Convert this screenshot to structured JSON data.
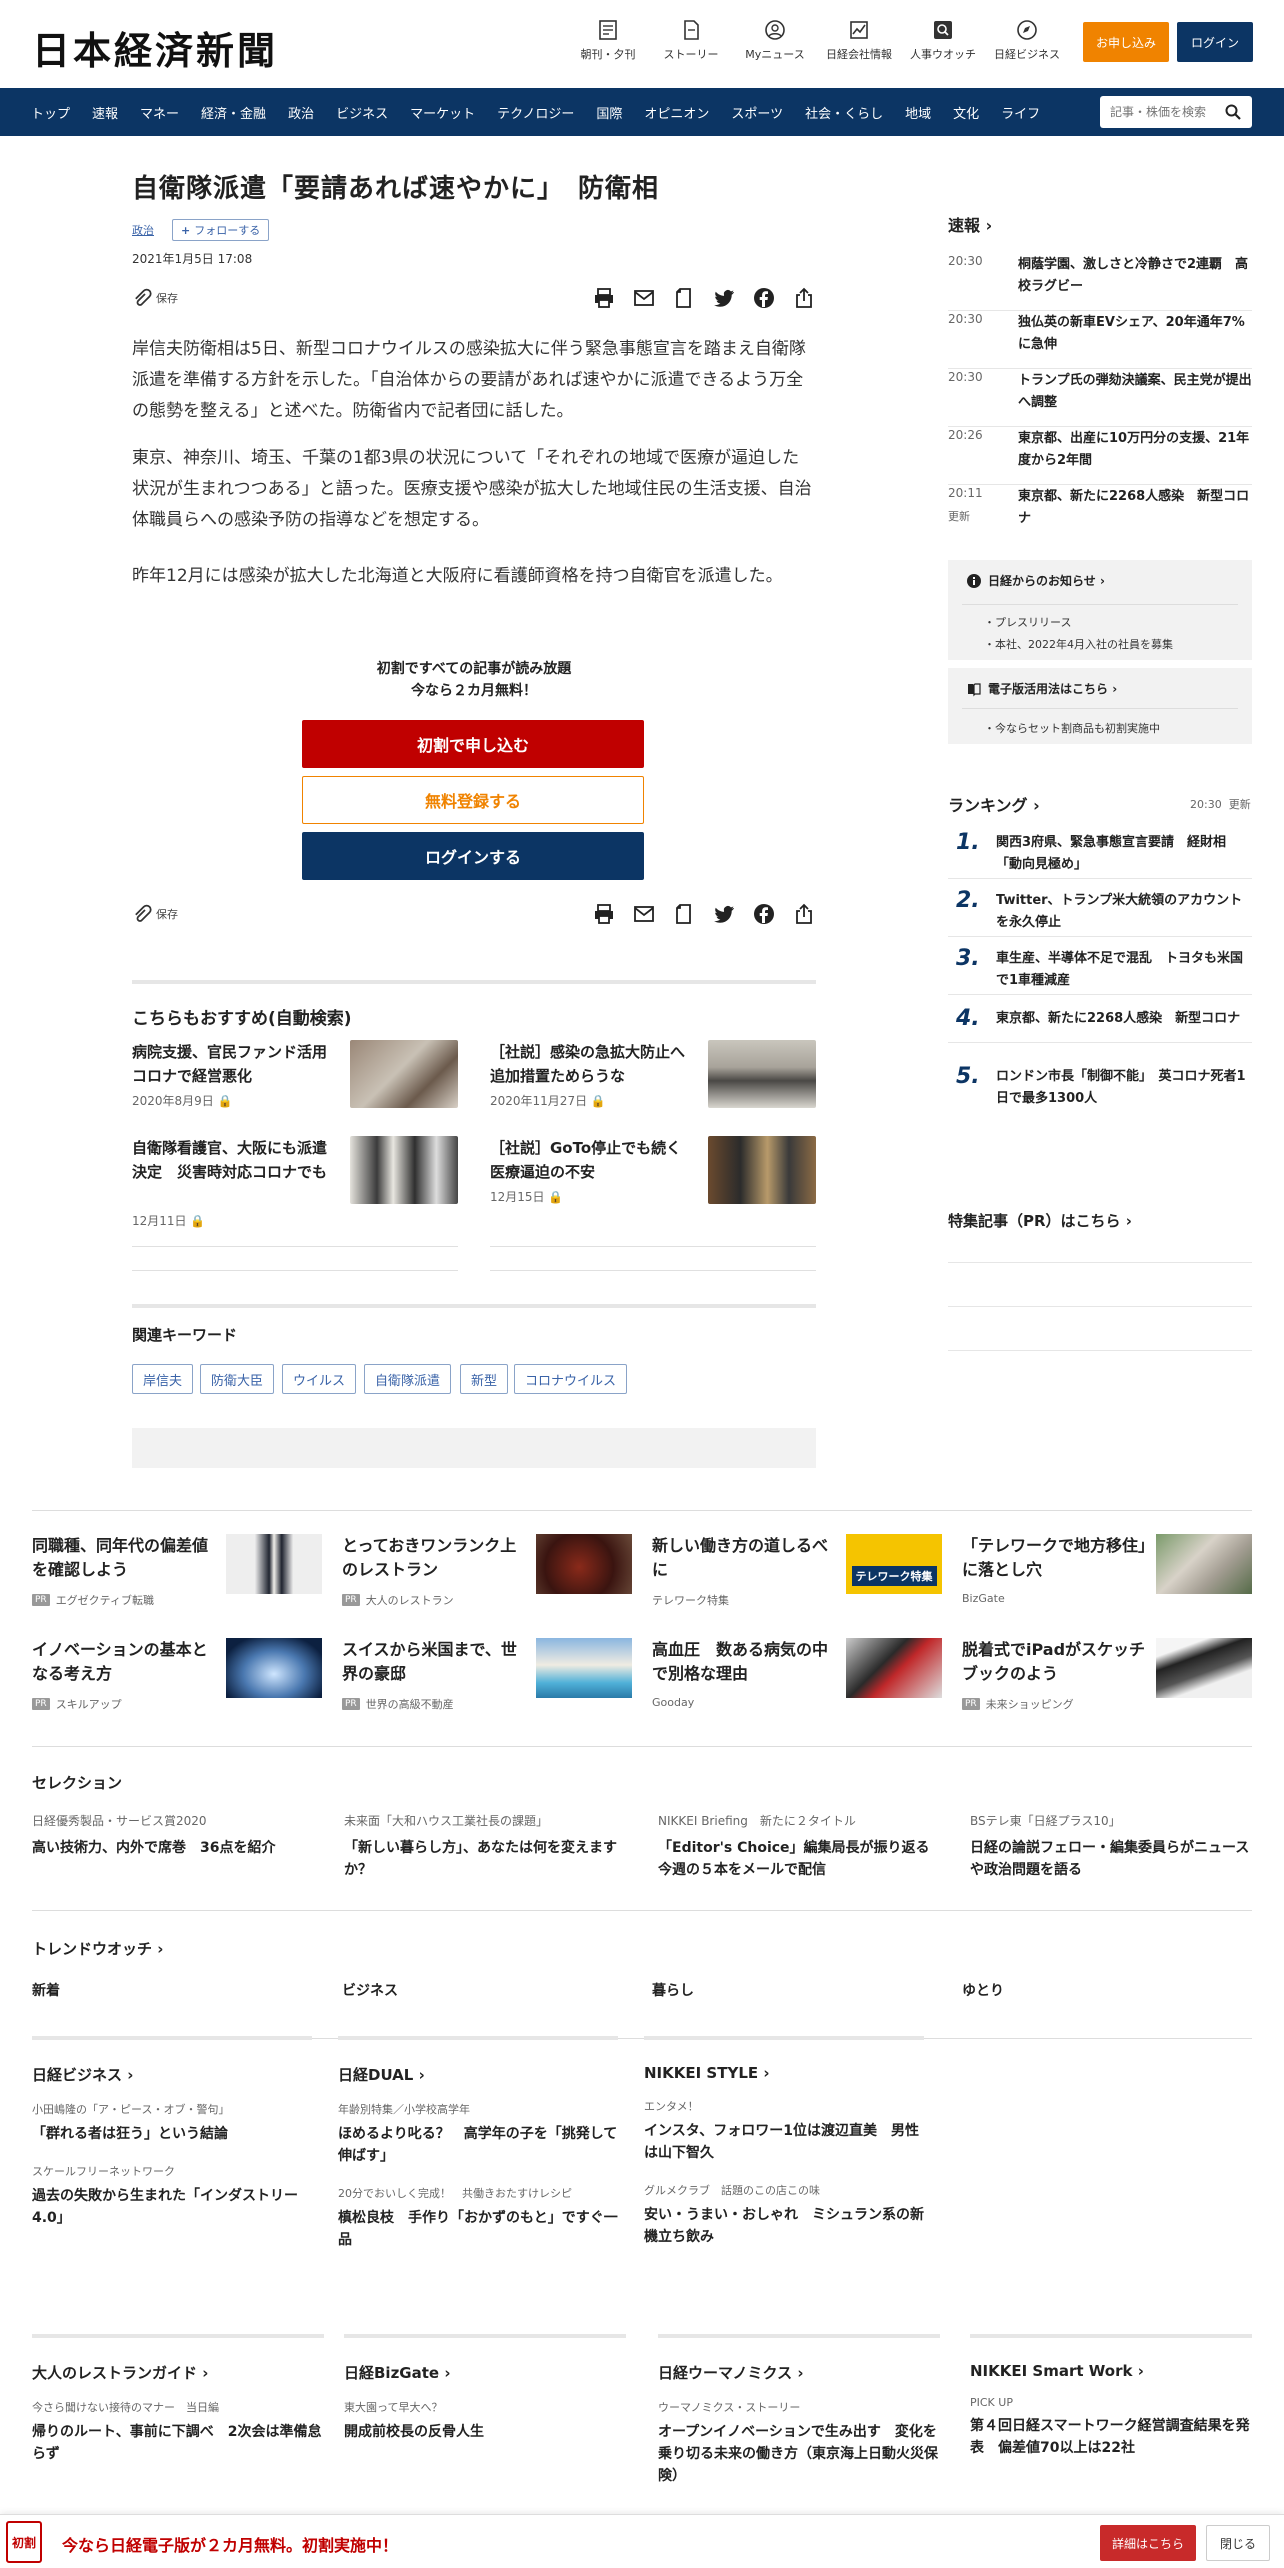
{
  "header": {
    "logo": "日本経済新聞",
    "icons": [
      {
        "label": "朝刊・夕刊",
        "icon": "newspaper-icon"
      },
      {
        "label": "ストーリー",
        "icon": "story-icon"
      },
      {
        "label": "Myニュース",
        "icon": "user-icon"
      },
      {
        "label": "日経会社情報",
        "icon": "chart-icon"
      },
      {
        "label": "人事ウオッチ",
        "icon": "search-person-icon"
      },
      {
        "label": "日経ビジネス",
        "icon": "compass-icon"
      }
    ],
    "subscribe": "お申し込み",
    "login": "ログイン"
  },
  "nav": {
    "items": [
      "トップ",
      "速報",
      "マネー",
      "経済・金融",
      "政治",
      "ビジネス",
      "マーケット",
      "テクノロジー",
      "国際",
      "オピニオン",
      "スポーツ",
      "社会・くらし",
      "地域",
      "文化",
      "ライフ"
    ],
    "search_placeholder": "記事・株価を検索"
  },
  "article": {
    "title": "自衛隊派遣「要請あれば速やかに」　防衛相",
    "category": "政治",
    "follow": "フォローする",
    "date": "2021年1月5日 17:08",
    "save": "保存",
    "paragraphs": [
      "岸信夫防衛相は5日、新型コロナウイルスの感染拡大に伴う緊急事態宣言を踏まえ自衛隊派遣を準備する方針を示した。「自治体からの要請があれば速やかに派遣できるよう万全の態勢を整える」と述べた。防衛省内で記者団に話した。",
      "東京、神奈川、埼玉、千葉の1都3県の状況について「それぞれの地域で医療が逼迫した状況が生まれつつある」と語った。医療支援や感染が拡大した地域住民の生活支援、自治体職員らへの感染予防の指導などを想定する。",
      "昨年12月には感染が拡大した北海道と大阪府に看護師資格を持つ自衛官を派遣した。"
    ],
    "promo_line1": "初割ですべての記事が読み放題",
    "promo_line2": "今なら２カ月無料！",
    "btn_apply": "初割で申し込む",
    "btn_free": "無料登録する",
    "btn_login": "ログインする"
  },
  "recommend": {
    "heading": "こちらもおすすめ(自動検索)",
    "items": [
      {
        "title": "病院支援、官民ファンド活用　コロナで経営悪化",
        "date": "2020年8月9日"
      },
      {
        "title": "［社説］感染の急拡大防止へ追加措置ためらうな",
        "date": "2020年11月27日"
      },
      {
        "title": "自衛隊看護官、大阪にも派遣決定　災害時対応コロナでも",
        "date": "12月11日"
      },
      {
        "title": "［社説］GoTo停止でも続く医療逼迫の不安",
        "date": "12月15日"
      }
    ]
  },
  "keywords": {
    "heading": "関連キーワード",
    "items": [
      "岸信夫",
      "防衛大臣",
      "ウイルス",
      "自衛隊派遣",
      "新型",
      "コロナウイルス"
    ]
  },
  "sidebar": {
    "news_heading": "速報",
    "news": [
      {
        "time": "20:30",
        "text": "桐蔭学園、激しさと冷静さで2連覇　高校ラグビー"
      },
      {
        "time": "20:30",
        "text": "独仏英の新車EVシェア、20年通年7%に急伸"
      },
      {
        "time": "20:30",
        "text": "トランプ氏の弾劾決議案、民主党が提出へ調整"
      },
      {
        "time": "20:26",
        "text": "東京都、出産に10万円分の支援、21年度から2年間"
      },
      {
        "time": "20:11",
        "text": "東京都、新たに2268人感染　新型コロナ"
      }
    ],
    "updated": "更新",
    "info_heading": "日経からのお知らせ",
    "info_items": [
      "プレスリリース",
      "本社、2022年4月入社の社員を募集"
    ],
    "ebook_heading": "電子版活用法はこちら",
    "ebook_items": [
      "今ならセット割商品も初割実施中"
    ],
    "ranking_heading": "ランキング",
    "ranking_time": "20:30",
    "ranking": [
      {
        "rank": "1.",
        "text": "関西3府県、緊急事態宣言要請　経財相「動向見極め」"
      },
      {
        "rank": "2.",
        "text": "Twitter、トランプ米大統領のアカウントを永久停止"
      },
      {
        "rank": "3.",
        "text": "車生産、半導体不足で混乱　トヨタも米国で1車種減産"
      },
      {
        "rank": "4.",
        "text": "東京都、新たに2268人感染　新型コロナ"
      },
      {
        "rank": "5.",
        "text": "ロンドン市長「制御不能」　英コロナ死者1日で最多1300人"
      }
    ],
    "pr_heading": "特集記事（PR）はこちら"
  },
  "promos": [
    {
      "title": "同職種、同年代の偏差値を確認しよう",
      "source": "エグゼクティブ転職",
      "pr": true
    },
    {
      "title": "とっておきワンランク上のレストラン",
      "source": "大人のレストラン",
      "pr": true
    },
    {
      "title": "新しい働き方の道しるべに",
      "source": "テレワーク特集",
      "pr": false
    },
    {
      "title": "「テレワークで地方移住」に落とし穴",
      "source": "BizGate",
      "pr": false
    },
    {
      "title": "イノベーションの基本となる考え方",
      "source": "スキルアップ",
      "pr": true
    },
    {
      "title": "スイスから米国まで、世界の豪邸",
      "source": "世界の高級不動産",
      "pr": true
    },
    {
      "title": "高血圧　数ある病気の中で別格な理由",
      "source": "Gooday",
      "pr": false
    },
    {
      "title": "脱着式でiPadがスケッチブックのよう",
      "source": "未来ショッピング",
      "pr": true
    }
  ],
  "pr_badge": "PR",
  "telework_banner": "テレワーク特集",
  "selection": {
    "heading": "セレクション",
    "items": [
      {
        "kicker": "日経優秀製品・サービス賞2020",
        "title": "高い技術力、内外で席巻　36点を紹介"
      },
      {
        "kicker": "未来面「大和ハウス工業社長の課題」",
        "title": "「新しい暮らし方」、あなたは何を変えますか？"
      },
      {
        "kicker": "NIKKEI Briefing　新たに２タイトル",
        "title": "「Editor's Choice」編集局長が振り返る今週の５本をメールで配信"
      },
      {
        "kicker": "BSテレ東「日経プラス10」",
        "title": "日経の論説フェロー・編集委員らがニュースや政治問題を語る"
      }
    ]
  },
  "trend": {
    "heading": "トレンドウオッチ",
    "tabs": [
      "新着",
      "ビジネス",
      "暮らし",
      "ゆとり"
    ]
  },
  "media": [
    {
      "heading": "日経ビジネス",
      "items": [
        {
          "kicker": "小田嶋隆の「ア・ピース・オブ・警句」",
          "title": "「群れる者は狂う」という結論"
        },
        {
          "kicker": "スケールフリーネットワーク",
          "title": "過去の失敗から生まれた「インダストリー4.0」"
        }
      ]
    },
    {
      "heading": "日経DUAL",
      "items": [
        {
          "kicker": "年齢別特集／小学校高学年",
          "title": "ほめるより叱る？　高学年の子を「挑発して伸ばす」"
        },
        {
          "kicker": "20分でおいしく完成！　共働きおたすけレシピ",
          "title": "槙松良枝　手作り「おかずのもと」ですぐ一品"
        }
      ]
    },
    {
      "heading": "NIKKEI STYLE",
      "items": [
        {
          "kicker": "エンタメ！",
          "title": "インスタ、フォロワー1位は渡辺直美　男性は山下智久"
        },
        {
          "kicker": "グルメクラブ　話題のこの店この味",
          "title": "安い・うまい・おしゃれ　ミシュラン系の新機立ち飲み"
        }
      ]
    }
  ],
  "media2": [
    {
      "heading": "大人のレストランガイド",
      "kicker": "今さら聞けない接待のマナー　当日編",
      "title": "帰りのルート、事前に下調べ　2次会は準備怠らず"
    },
    {
      "heading": "日経BizGate",
      "kicker": "東大園って早大へ？",
      "title": "開成前校長の反骨人生"
    },
    {
      "heading": "日経ウーマノミクス",
      "kicker": "ウーマノミクス・ストーリー",
      "title": "オープンイノベーションで生み出す　変化を乗り切る未来の働き方（東京海上日動火災保険）"
    },
    {
      "heading": "NIKKEI Smart Work",
      "kicker": "PICK UP",
      "title": "第４回日経スマートワーク経営調査結果を発表　偏差値70以上は22社"
    }
  ],
  "footer": {
    "badge": "初割",
    "text": "今なら日経電子版が２カ月無料。初割実施中！",
    "detail": "詳細はこちら",
    "close": "閉じる"
  },
  "colors": {
    "navy": "#0c3564",
    "orange": "#f08300",
    "red": "#c00000",
    "link": "#3a63a8"
  }
}
